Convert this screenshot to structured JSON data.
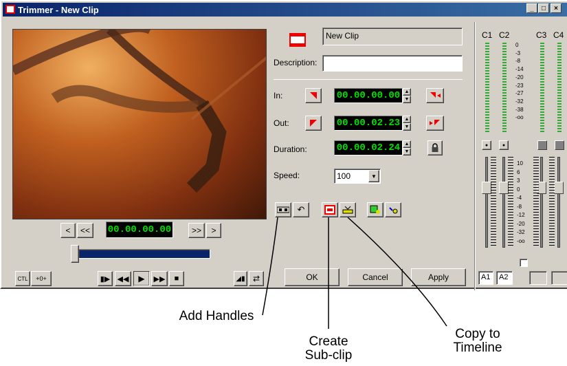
{
  "window": {
    "title": "Trimmer - New Clip",
    "minimize": "_",
    "maximize": "□",
    "close": "×"
  },
  "clip": {
    "name": "New Clip",
    "description_label": "Description:",
    "description_value": ""
  },
  "in": {
    "label": "In:",
    "timecode": "00.00.00.00"
  },
  "out": {
    "label": "Out:",
    "timecode": "00.00.02.23"
  },
  "duration": {
    "label": "Duration:",
    "timecode": "00.00.02.24"
  },
  "speed": {
    "label": "Speed:",
    "value": "100"
  },
  "transport": {
    "timecode": "00.00.00.00",
    "prev": "<",
    "rew": "<<",
    "fwd": ">>",
    "next": ">",
    "ctl": "CTL",
    "goto": "+0+"
  },
  "buttons": {
    "ok": "OK",
    "cancel": "Cancel",
    "apply": "Apply"
  },
  "mixer": {
    "channels": [
      "C1",
      "C2",
      "C3",
      "C4"
    ],
    "db_scale": [
      "0",
      "-3",
      "-8",
      "-14",
      "-20",
      "-23",
      "-27",
      "-32",
      "-38",
      "-oo"
    ],
    "fader_scale": [
      "10",
      "6",
      "3",
      "0",
      "-4",
      "-8",
      "-12",
      "-20",
      "-32",
      "-oo"
    ],
    "audio_tracks": [
      "A1",
      "A2"
    ]
  },
  "annotations": {
    "add_handles": "Add Handles",
    "create_subclip": "Create\nSub-clip",
    "copy_timeline": "Copy to\nTimeline"
  },
  "colors": {
    "timecode_fg": "#00e000",
    "title_bg": "#0a246a",
    "mark_red": "#e00000"
  }
}
